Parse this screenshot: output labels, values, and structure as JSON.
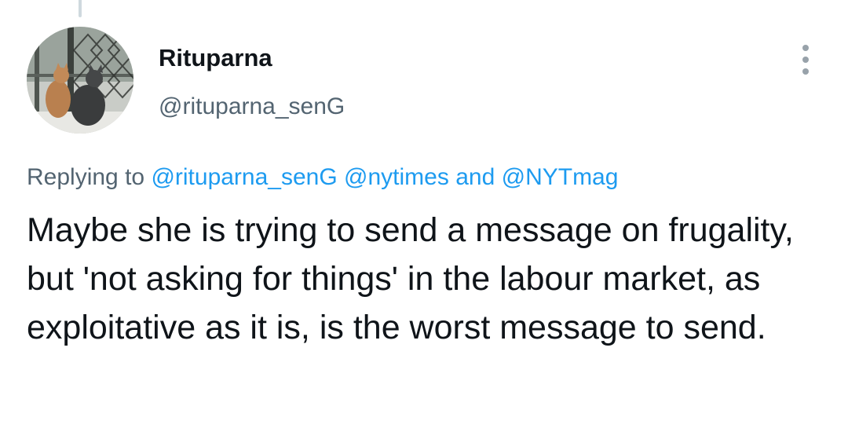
{
  "tweet": {
    "author": {
      "name": "Rituparna",
      "handle": "@rituparna_senG",
      "avatar_icon": "profile-photo-two-cats-at-window"
    },
    "reply_context": {
      "prefix": "Replying to",
      "mention_1": "@rituparna_senG",
      "mention_2": "@nytimes",
      "conjunction": "and",
      "mention_3": "@NYTmag"
    },
    "text": "Maybe she is trying to send a message on frugality, but 'not asking for things' in the labour market, as exploitative as it is, is the worst message to send.",
    "menu_icon": "more-vertical-icon"
  },
  "colors": {
    "text_primary": "#0f1419",
    "text_secondary": "#536471",
    "link": "#1d9bf0",
    "thread_line": "#cfd9de"
  }
}
